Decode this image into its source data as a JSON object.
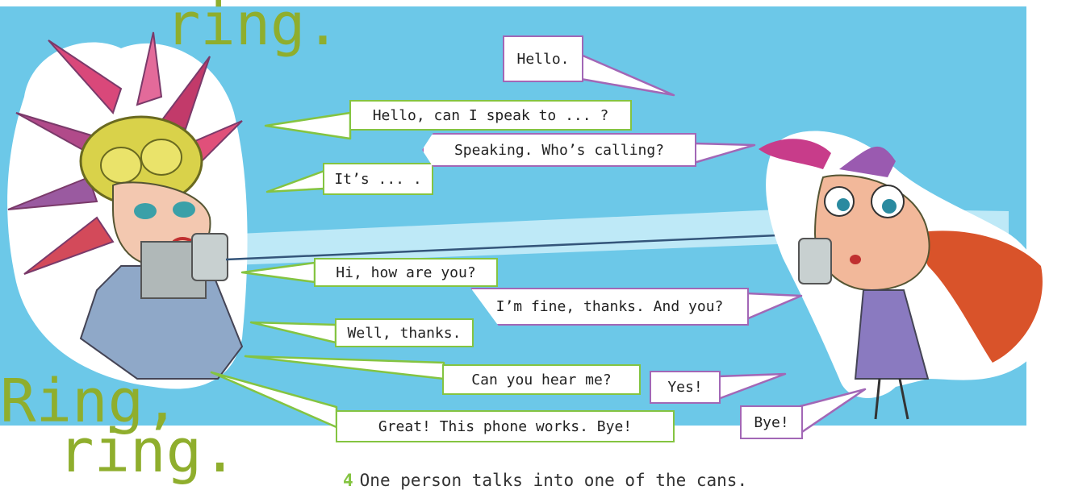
{
  "colors": {
    "sky": "#6cc8e8",
    "green_accent": "#84c441",
    "purple_accent": "#a267b6",
    "sfx_green": "#8fae2d"
  },
  "sound_effects": {
    "top": "ring.",
    "bottom_line1": "Ring,",
    "bottom_line2": "ring."
  },
  "dialogue": {
    "left_speaker": [
      "Hello, can I speak to ... ?",
      "It’s ... .",
      "Hi, how are you?",
      "Well, thanks.",
      "Can you hear me?",
      "Great! This phone works. Bye!"
    ],
    "right_speaker": [
      "Hello.",
      "Speaking. Who’s calling?",
      "I’m fine, thanks. And you?",
      "Yes!",
      "Bye!"
    ]
  },
  "illustration": {
    "left_character": "boy-with-spiky-hair-holding-tin-can",
    "right_character": "girl-with-red-hair-holding-tin-can",
    "device": "tin-can-string-phone"
  },
  "instruction": {
    "number": "4",
    "text": "One person talks into one of the cans."
  }
}
